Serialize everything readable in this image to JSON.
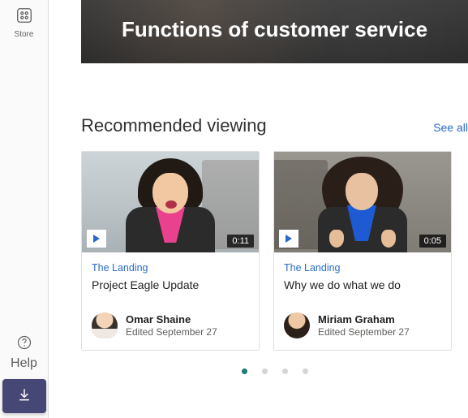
{
  "sidebar": {
    "store_label": "Store",
    "help_label": "Help"
  },
  "hero": {
    "title": "Functions of customer service"
  },
  "section": {
    "title": "Recommended viewing",
    "see_all": "See all"
  },
  "cards": [
    {
      "channel": "The Landing",
      "title": "Project Eagle Update",
      "duration": "0:11",
      "author": "Omar Shaine",
      "edited": "Edited September 27"
    },
    {
      "channel": "The Landing",
      "title": "Why we do what we do",
      "duration": "0:05",
      "author": "Miriam Graham",
      "edited": "Edited September 27"
    }
  ],
  "carousel": {
    "count": 4,
    "active": 0
  }
}
